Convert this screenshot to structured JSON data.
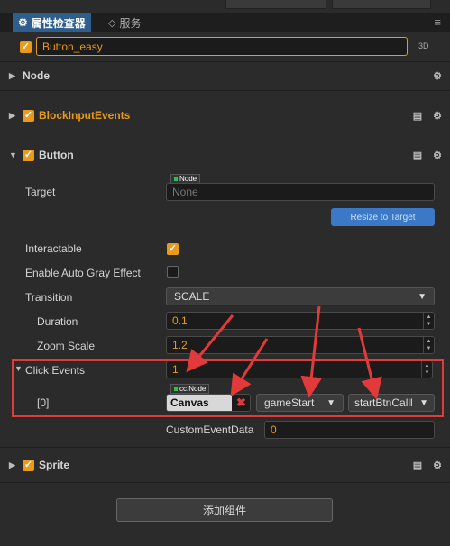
{
  "tabs": {
    "inspector_label": "属性检查器",
    "service_label": "服务"
  },
  "node": {
    "name": "Button_easy",
    "mode_3d": "3D"
  },
  "components": {
    "node_label": "Node",
    "block_label": "BlockInputEvents",
    "button_label": "Button",
    "sprite_label": "Sprite"
  },
  "button": {
    "target_label": "Target",
    "target_tag": "Node",
    "target_value": "None",
    "resize_label": "Resize to Target",
    "interactable_label": "Interactable",
    "auto_gray_label": "Enable Auto Gray Effect",
    "transition_label": "Transition",
    "transition_value": "SCALE",
    "duration_label": "Duration",
    "duration_value": "0.1",
    "zoom_label": "Zoom Scale",
    "zoom_value": "1.2",
    "click_events_label": "Click Events",
    "click_events_value": "1",
    "event_index_label": "[0]",
    "event_target_tag": "cc.Node",
    "event_target_value": "Canvas",
    "event_component_value": "gameStart",
    "event_handler_value": "startBtnCalll",
    "custom_data_label": "CustomEventData",
    "custom_data_value": "0"
  },
  "footer": {
    "add_component_label": "添加组件"
  },
  "colors": {
    "accent_orange": "#e89a1c",
    "tab_active": "#2d5e8e",
    "resize_button": "#3b78c8",
    "annotation_red": "#e23a3a"
  },
  "icons": [
    "gear-icon",
    "book-icon",
    "eye-icon",
    "menu-icon",
    "checkmark-icon"
  ]
}
